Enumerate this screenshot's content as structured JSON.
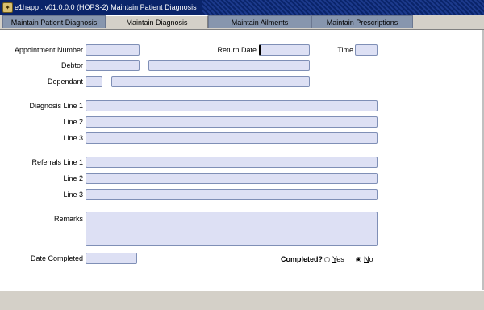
{
  "window": {
    "title": "e1happ : v01.0.0.0 (HOPS-2) Maintain Patient Diagnosis"
  },
  "tabs": [
    {
      "label": "Maintain Patient Diagnosis",
      "active": false
    },
    {
      "label": "Maintain Diagnosis",
      "active": true
    },
    {
      "label": "Maintain Ailments",
      "active": false
    },
    {
      "label": "Maintain Prescriptions",
      "active": false
    }
  ],
  "form": {
    "appointment_number": {
      "label": "Appointment Number",
      "value": ""
    },
    "return_date": {
      "label": "Return Date",
      "value": ""
    },
    "time": {
      "label": "Time",
      "value": ""
    },
    "debtor": {
      "label": "Debtor",
      "code": "",
      "name": ""
    },
    "dependant": {
      "label": "Dependant",
      "code": "",
      "name": ""
    },
    "diagnosis": {
      "line1_label": "Diagnosis Line 1",
      "line2_label": "Line 2",
      "line3_label": "Line 3"
    },
    "referrals": {
      "line1_label": "Referrals Line 1",
      "line2_label": "Line 2",
      "line3_label": "Line 3"
    },
    "remarks": {
      "label": "Remarks",
      "value": ""
    },
    "date_completed": {
      "label": "Date Completed",
      "value": ""
    },
    "completed": {
      "label": "Completed?",
      "yes_prefix": "",
      "yes_key": "Y",
      "yes_rest": "es",
      "no_prefix": "",
      "no_key": "N",
      "no_rest": "o",
      "selected": "No"
    }
  },
  "colors": {
    "field_bg": "#dde0f4",
    "tab_inactive": "#8796ae",
    "titlebar": "#0a246a"
  }
}
